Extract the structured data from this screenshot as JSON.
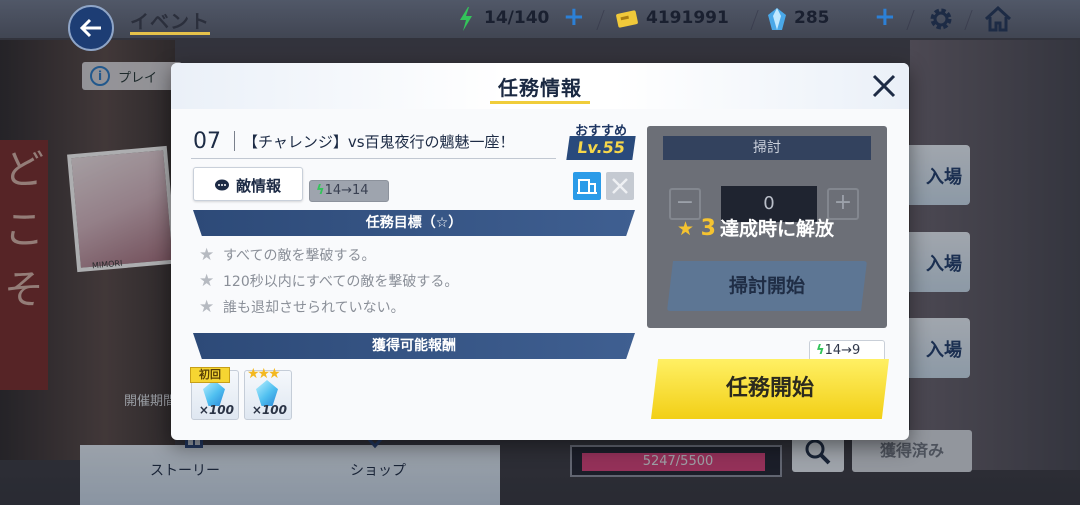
{
  "topbar": {
    "title": "イベント",
    "stamina": "14/140",
    "coins": "4191991",
    "gems": "285"
  },
  "background": {
    "notice": "プレイ",
    "photo_caption": "MIMORI",
    "kaisai": "開催期間",
    "entries": [
      "入場",
      "入場",
      "入場"
    ],
    "sign": [
      "ど",
      "こ",
      "そ"
    ]
  },
  "bottom": {
    "story_label": "ストーリー",
    "shop_label": "ショップ",
    "progress_text": "5247/5500",
    "progress_fraction": 0.954,
    "obtained_label": "獲得済み"
  },
  "modal": {
    "title": "任務情報",
    "stage_number": "07",
    "stage_name": "【チャレンジ】vs百鬼夜行の魑魅一座！",
    "recommended_label": "おすすめ",
    "recommended_level": "Lv.55",
    "enemy_info_label": "敵情報",
    "goals_header": "任務目標（☆）",
    "goals": [
      "すべての敵を撃破する。",
      "120秒以内にすべての敵を撃破する。",
      "誰も退却させられていない。"
    ],
    "rewards_header": "獲得可能報酬",
    "rewards": [
      {
        "tag": "初回",
        "qty": "×100"
      },
      {
        "tag": "★★★",
        "qty": "×100"
      }
    ],
    "sweep": {
      "title": "掃討",
      "count": "0",
      "unlock_number": "3",
      "unlock_text": "達成時に解放",
      "cost_from": "14",
      "cost_to": "14",
      "start_label": "掃討開始"
    },
    "mission": {
      "cost_from": "14",
      "cost_to": "9",
      "start_label": "任務開始"
    }
  },
  "colors": {
    "accent_yellow": "#f2cf16",
    "section_blue": "#2d4a78",
    "stamina_green": "#33c45a"
  }
}
